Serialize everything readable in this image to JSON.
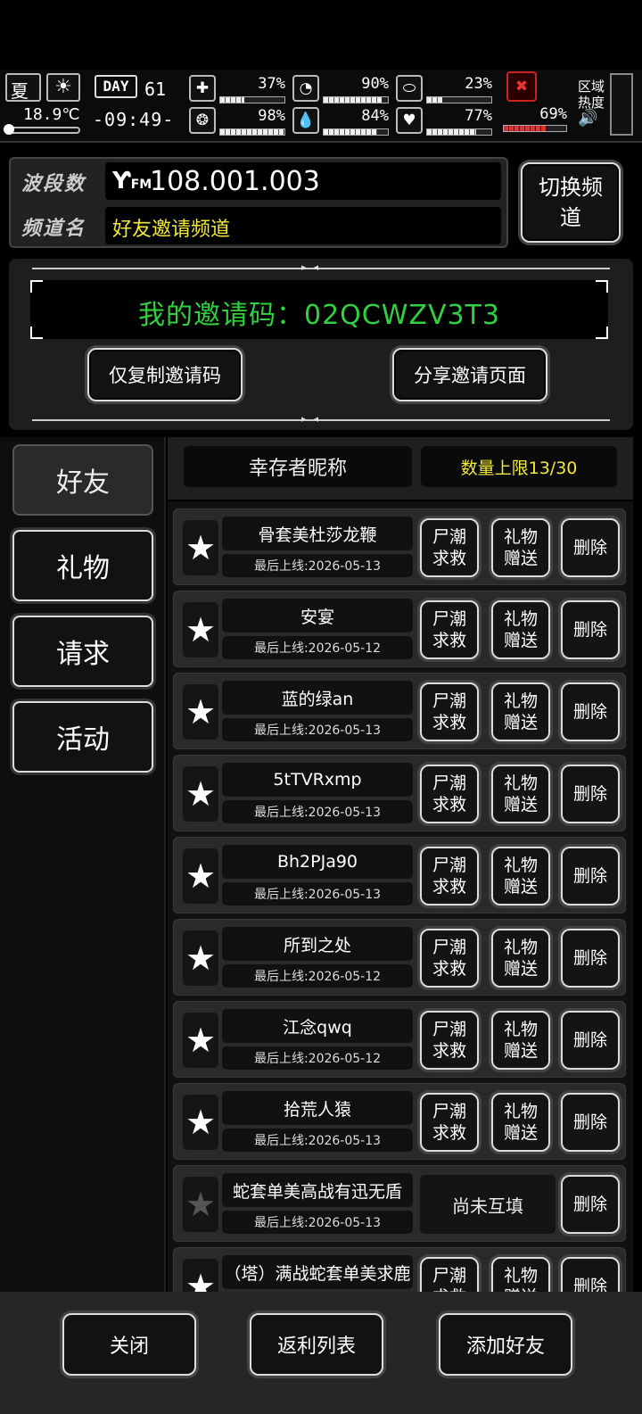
{
  "status": {
    "season": "夏",
    "weather_icon": "sun-icon",
    "temperature": "18.9℃",
    "day_label": "DAY",
    "day_number": "61",
    "time": "-09:49-",
    "stats": [
      {
        "name": "health",
        "icon": "medkit-icon",
        "glyph": "✚",
        "value": "37%",
        "fill": 0.37
      },
      {
        "name": "hunger",
        "icon": "stomach-icon",
        "glyph": "◔",
        "value": "90%",
        "fill": 0.9
      },
      {
        "name": "stamina",
        "icon": "pill-icon",
        "glyph": "⬭",
        "value": "23%",
        "fill": 0.23
      },
      {
        "name": "sanity",
        "icon": "brain-icon",
        "glyph": "❂",
        "value": "98%",
        "fill": 0.98
      },
      {
        "name": "thirst",
        "icon": "water-drop-icon",
        "glyph": "💧",
        "value": "84%",
        "fill": 0.84
      },
      {
        "name": "mood",
        "icon": "heart-icon",
        "glyph": "♥",
        "value": "77%",
        "fill": 0.77
      },
      {
        "name": "infection",
        "icon": "infection-icon",
        "glyph": "✖",
        "value": "69%",
        "fill": 0.69
      }
    ],
    "zone_label_1": "区域",
    "zone_label_2": "热度"
  },
  "channel": {
    "band_label": "波段数",
    "band_value": "108.001.003",
    "name_label": "频道名",
    "name_value": "好友邀请频道",
    "switch_button": "切换频道"
  },
  "invite": {
    "code_text": "我的邀请码：02QCWZV3T3",
    "copy_button": "仅复制邀请码",
    "share_button": "分享邀请页面"
  },
  "tabs": [
    {
      "label": "好友",
      "active": true
    },
    {
      "label": "礼物",
      "active": false
    },
    {
      "label": "请求",
      "active": false
    },
    {
      "label": "活动",
      "active": false
    }
  ],
  "list_header": {
    "nickname": "幸存者昵称",
    "limit": "数量上限13/30"
  },
  "row_labels": {
    "rescue": "尸潮求救",
    "gift": "礼物赠送",
    "delete": "删除",
    "pending": "尚未互填"
  },
  "friends": [
    {
      "name": "骨套美杜莎龙鞭",
      "online": "最后上线:2026-05-13",
      "mutual": true
    },
    {
      "name": "安宴",
      "online": "最后上线:2026-05-12",
      "mutual": true
    },
    {
      "name": "蓝的绿an",
      "online": "最后上线:2026-05-13",
      "mutual": true
    },
    {
      "name": "5tTVRxmp",
      "online": "最后上线:2026-05-13",
      "mutual": true
    },
    {
      "name": "Bh2PJa90",
      "online": "最后上线:2026-05-13",
      "mutual": true
    },
    {
      "name": "所到之处",
      "online": "最后上线:2026-05-12",
      "mutual": true
    },
    {
      "name": "江念qwq",
      "online": "最后上线:2026-05-12",
      "mutual": true
    },
    {
      "name": "拾荒人猿",
      "online": "最后上线:2026-05-13",
      "mutual": true
    },
    {
      "name": "蛇套单美高战有迅无盾",
      "online": "最后上线:2026-05-13",
      "mutual": false
    },
    {
      "name": "（塔）满战蛇套单美求鹿",
      "online": "",
      "mutual": true
    }
  ],
  "bottom": {
    "close": "关闭",
    "rebate": "返利列表",
    "add_friend": "添加好友"
  }
}
